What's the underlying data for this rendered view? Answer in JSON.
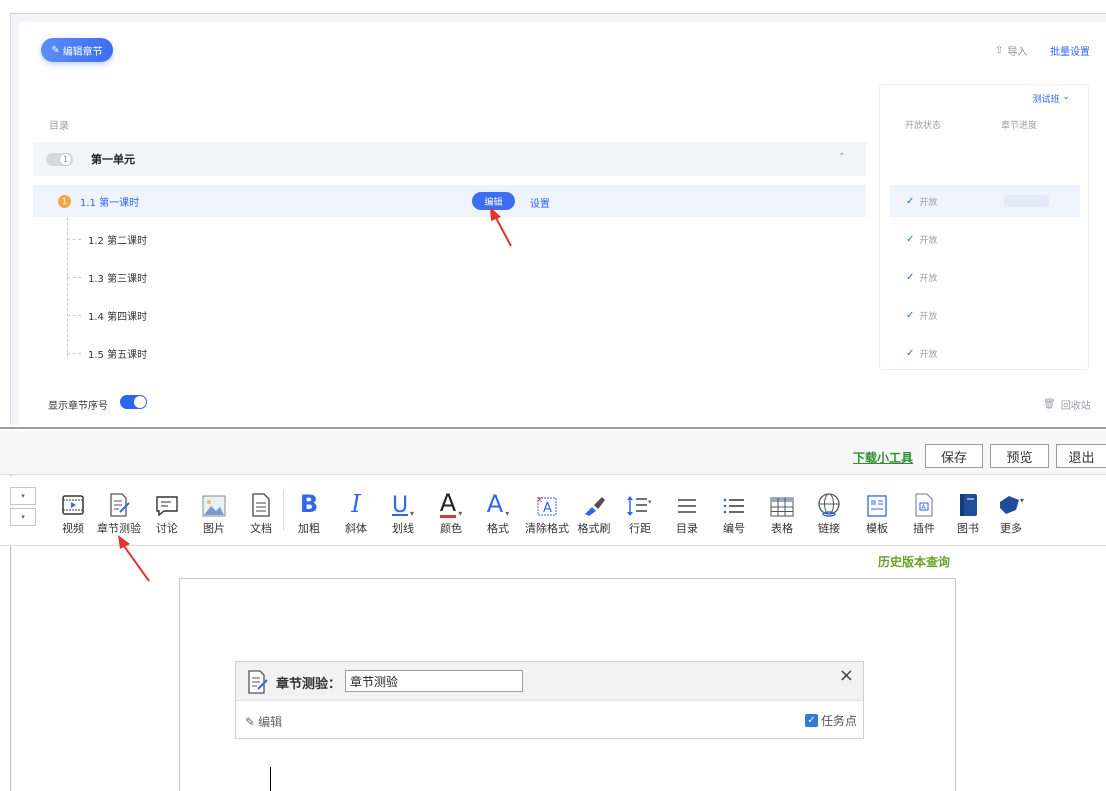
{
  "colors": {
    "accent": "#3d6ef0",
    "link": "#2f66f0",
    "green": "#2f8f2f",
    "history_green": "#6aa22a",
    "arrow_red": "#e2342b",
    "badge_orange": "#f5a545"
  },
  "chapter_panel": {
    "edit_chapter_label": "编辑章节",
    "edit_chapter_icon": "edit-square-icon",
    "import_label": "导入",
    "import_icon": "upload-icon",
    "batch_settings_label": "批量设置",
    "catalog_label": "目录",
    "unit": {
      "number": "1",
      "title": "第一单元",
      "chevron_icon": "chevron-up-icon"
    },
    "lessons": [
      {
        "badge": "1",
        "title": "1.1 第一课时",
        "active": true
      },
      {
        "title": "1.2 第二课时"
      },
      {
        "title": "1.3 第三课时"
      },
      {
        "title": "1.4 第四课时"
      },
      {
        "title": "1.5 第五课时"
      }
    ],
    "edit_pill_label": "编辑",
    "settings_label": "设置",
    "status": {
      "class_select": "测试班",
      "col_open_status": "开放状态",
      "col_progress": "章节进度",
      "rows": [
        "开放",
        "开放",
        "开放",
        "开放",
        "开放"
      ]
    },
    "show_number_label": "显示章节序号",
    "show_number_on": true,
    "recycle_label": "回收站"
  },
  "editor": {
    "download_tool": "下载小工具",
    "save": "保存",
    "preview": "预览",
    "exit": "退出",
    "tools": {
      "video": "视频",
      "chapter_quiz": "章节测验",
      "discussion": "讨论",
      "image": "图片",
      "doc": "文档",
      "bold": "加粗",
      "italic": "斜体",
      "underline": "划线",
      "color": "颜色",
      "format": "格式",
      "clear_format": "清除格式",
      "format_brush": "格式刷",
      "line_height": "行距",
      "catalog": "目录",
      "numbering": "编号",
      "table": "表格",
      "link": "链接",
      "template": "模板",
      "plugin": "插件",
      "book": "图书",
      "more": "更多"
    },
    "glyphs": {
      "bold": "B",
      "italic": "I",
      "underline": "U",
      "color": "A",
      "format": "A"
    },
    "history_link": "历史版本查询",
    "quiz": {
      "label": "章节测验：",
      "value": "章节测验",
      "close": "×",
      "edit": "编辑",
      "task_point": "任务点",
      "task_checked": true
    }
  }
}
